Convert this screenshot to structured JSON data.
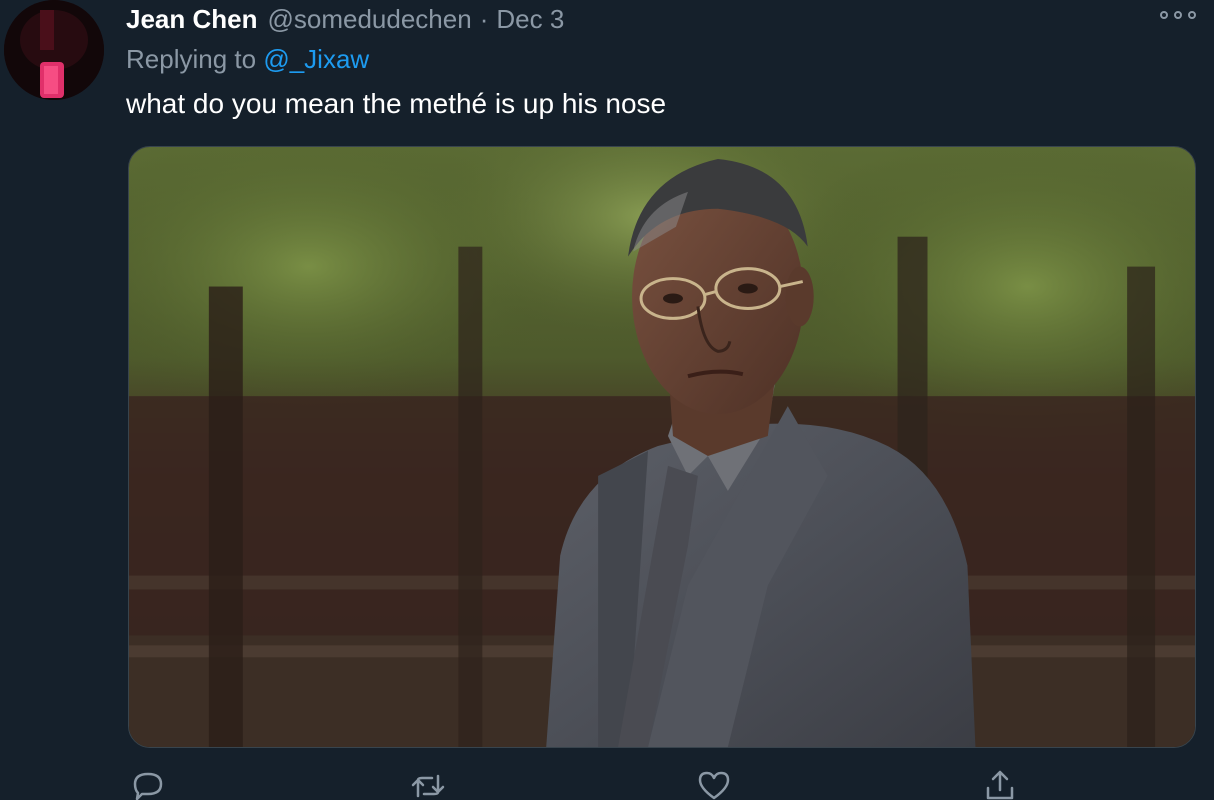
{
  "tweet": {
    "author": {
      "display_name": "Jean Chen",
      "handle": "@somedudechen",
      "avatar_icon": "avatar-image"
    },
    "separator": "·",
    "date": "Dec 3",
    "reply": {
      "prefix": "Replying to ",
      "mention": "@_Jixaw"
    },
    "text": "what do you mean the methé is up his nose",
    "media": {
      "kind": "photo",
      "icon": "tweet-photo"
    },
    "actions": [
      {
        "name": "reply",
        "icon": "reply-icon"
      },
      {
        "name": "retweet",
        "icon": "retweet-icon"
      },
      {
        "name": "like",
        "icon": "heart-icon"
      },
      {
        "name": "share",
        "icon": "share-icon"
      }
    ]
  },
  "colors": {
    "background": "#15202b",
    "primary_text": "#ffffff",
    "secondary_text": "#8b98a5",
    "link": "#1d9bf0"
  }
}
